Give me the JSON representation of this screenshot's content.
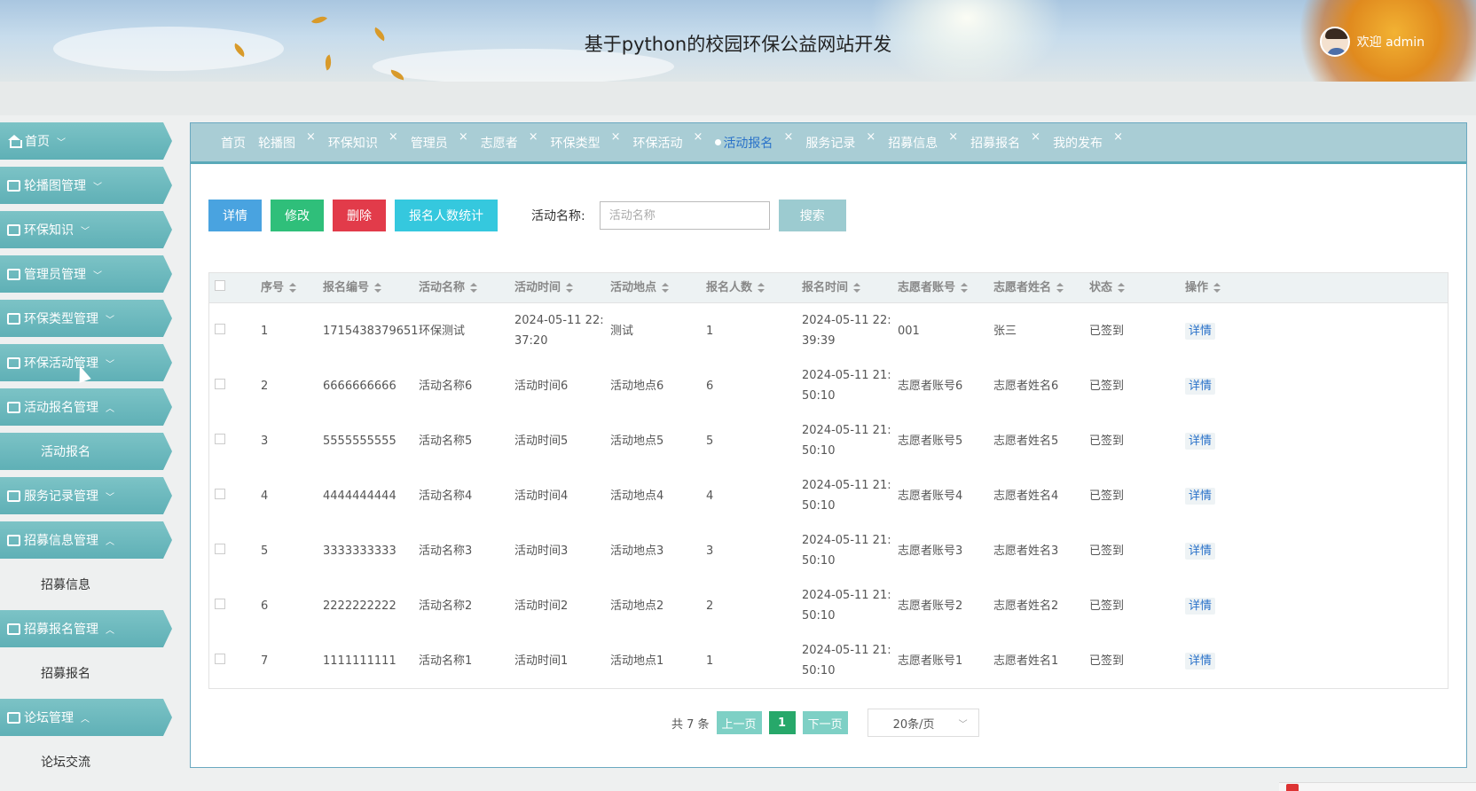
{
  "header": {
    "title": "基于python的校园环保公益网站开发",
    "welcome": "欢迎 admin"
  },
  "sidebar": {
    "items": [
      {
        "label": "首页",
        "type": "menu",
        "icon": "home-icon",
        "chevron": "﹀"
      },
      {
        "label": "轮播图管理",
        "type": "menu",
        "icon": "image-icon",
        "chevron": "﹀"
      },
      {
        "label": "环保知识",
        "type": "menu",
        "icon": "book-icon",
        "chevron": "﹀"
      },
      {
        "label": "管理员管理",
        "type": "menu",
        "icon": "edit-icon",
        "chevron": "﹀"
      },
      {
        "label": "环保类型管理",
        "type": "menu",
        "icon": "chart-icon",
        "chevron": "﹀"
      },
      {
        "label": "环保活动管理",
        "type": "menu",
        "icon": "briefcase-icon",
        "chevron": "﹀"
      },
      {
        "label": "活动报名管理",
        "type": "menu",
        "icon": "building-icon",
        "chevron": "︿"
      },
      {
        "label": "活动报名",
        "type": "sub",
        "active": true
      },
      {
        "label": "服务记录管理",
        "type": "menu",
        "icon": "table-icon",
        "chevron": "﹀"
      },
      {
        "label": "招募信息管理",
        "type": "menu",
        "icon": "document-icon",
        "chevron": "︿"
      },
      {
        "label": "招募信息",
        "type": "sub",
        "active": false
      },
      {
        "label": "招募报名管理",
        "type": "menu",
        "icon": "card-icon",
        "chevron": "︿"
      },
      {
        "label": "招募报名",
        "type": "sub",
        "active": false
      },
      {
        "label": "论坛管理",
        "type": "menu",
        "icon": "chat-icon",
        "chevron": "︿"
      },
      {
        "label": "论坛交流",
        "type": "sub",
        "active": false
      }
    ]
  },
  "tabs": [
    {
      "label": "首页",
      "closable": false,
      "active": false
    },
    {
      "label": "轮播图",
      "closable": true,
      "active": false
    },
    {
      "label": "环保知识",
      "closable": true,
      "active": false
    },
    {
      "label": "管理员",
      "closable": true,
      "active": false
    },
    {
      "label": "志愿者",
      "closable": true,
      "active": false
    },
    {
      "label": "环保类型",
      "closable": true,
      "active": false
    },
    {
      "label": "环保活动",
      "closable": true,
      "active": false
    },
    {
      "label": "活动报名",
      "closable": true,
      "active": true
    },
    {
      "label": "服务记录",
      "closable": true,
      "active": false
    },
    {
      "label": "招募信息",
      "closable": true,
      "active": false
    },
    {
      "label": "招募报名",
      "closable": true,
      "active": false
    },
    {
      "label": "我的发布",
      "closable": true,
      "active": false
    }
  ],
  "tab_close_glyph": "×",
  "toolbar": {
    "detail": "详情",
    "edit": "修改",
    "delete": "删除",
    "stats": "报名人数统计",
    "search_label": "活动名称:",
    "search_placeholder": "活动名称",
    "search_button": "搜索"
  },
  "table": {
    "columns": [
      "序号",
      "报名编号",
      "活动名称",
      "活动时间",
      "活动地点",
      "报名人数",
      "报名时间",
      "志愿者账号",
      "志愿者姓名",
      "状态",
      "操作"
    ],
    "rows": [
      [
        "1",
        "1715438379651",
        "环保测试",
        "2024-05-11 22:37:20",
        "测试",
        "1",
        "2024-05-11 22:39:39",
        "001",
        "张三",
        "已签到",
        "详情"
      ],
      [
        "2",
        "6666666666",
        "活动名称6",
        "活动时间6",
        "活动地点6",
        "6",
        "2024-05-11 21:50:10",
        "志愿者账号6",
        "志愿者姓名6",
        "已签到",
        "详情"
      ],
      [
        "3",
        "5555555555",
        "活动名称5",
        "活动时间5",
        "活动地点5",
        "5",
        "2024-05-11 21:50:10",
        "志愿者账号5",
        "志愿者姓名5",
        "已签到",
        "详情"
      ],
      [
        "4",
        "4444444444",
        "活动名称4",
        "活动时间4",
        "活动地点4",
        "4",
        "2024-05-11 21:50:10",
        "志愿者账号4",
        "志愿者姓名4",
        "已签到",
        "详情"
      ],
      [
        "5",
        "3333333333",
        "活动名称3",
        "活动时间3",
        "活动地点3",
        "3",
        "2024-05-11 21:50:10",
        "志愿者账号3",
        "志愿者姓名3",
        "已签到",
        "详情"
      ],
      [
        "6",
        "2222222222",
        "活动名称2",
        "活动时间2",
        "活动地点2",
        "2",
        "2024-05-11 21:50:10",
        "志愿者账号2",
        "志愿者姓名2",
        "已签到",
        "详情"
      ],
      [
        "7",
        "1111111111",
        "活动名称1",
        "活动时间1",
        "活动地点1",
        "1",
        "2024-05-11 21:50:10",
        "志愿者账号1",
        "志愿者姓名1",
        "已签到",
        "详情"
      ]
    ]
  },
  "pagination": {
    "total": "共 7 条",
    "prev": "上一页",
    "current": "1",
    "next": "下一页",
    "page_size": "20条/页"
  },
  "colors": {
    "accent": "#5fb0b6",
    "tab_active": "#2a72c9",
    "btn_detail": "#49a3e0",
    "btn_edit": "#2fbf7a",
    "btn_delete": "#e23b4a",
    "btn_stats": "#35c8de"
  }
}
